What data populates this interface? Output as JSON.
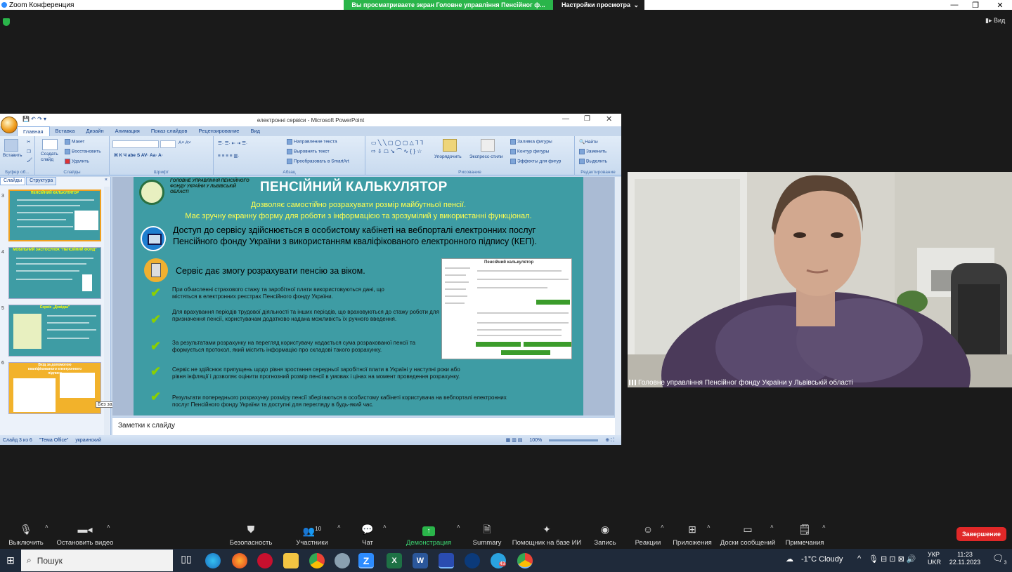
{
  "zoom": {
    "window_title": "Zoom Конференция",
    "share_banner": "Вы просматриваете экран Головне управління Пенсійног ф...",
    "view_settings": "Настройки просмотра",
    "view_label": "Вид"
  },
  "ppt": {
    "window_title": "електронні сервіси - Microsoft PowerPoint",
    "tabs": [
      "Главная",
      "Вставка",
      "Дизайн",
      "Анимация",
      "Показ слайдов",
      "Рецензирование",
      "Вид"
    ],
    "ribbon": {
      "paste": "Вставить",
      "clipboard_group": "Буфер об...",
      "layout": "Макет",
      "restore": "Восстановить",
      "delete": "Удалить",
      "new_slide": "Создать слайд",
      "slides_group": "Слайды",
      "font_group": "Шрифт",
      "text_direction": "Направление текста",
      "align_text": "Выровнять текст",
      "smartart": "Преобразовать в SmartArt",
      "paragraph_group": "Абзац",
      "arrange": "Упорядочить",
      "quick_styles": "Экспресс-стили",
      "shape_fill": "Заливка фигуры",
      "shape_outline": "Контур фигуры",
      "shape_effects": "Эффекты для фигур",
      "drawing_group": "Рисование",
      "find": "Найти",
      "replace": "Заменить",
      "select": "Выделить",
      "editing_group": "Редактирование"
    },
    "panel_tabs": [
      "Слайды",
      "Структура"
    ],
    "thumbnails": [
      {
        "num": "3",
        "title": "ПЕНСІЙНИЙ КАЛЬКУЛЯТОР"
      },
      {
        "num": "4",
        "title": "МОБІЛЬНИЙ ЗАСТОСУНОК \"ПЕНСІЙНИЙ ФОНД\""
      },
      {
        "num": "5",
        "title": "Сервіс „Довідка\""
      },
      {
        "num": "6",
        "title": "Вхід за допомогою кваліфікованого електронного підпису"
      }
    ],
    "tooltip": "Без заголовка",
    "notes_placeholder": "Заметки к слайду",
    "status": {
      "slide": "Слайд 3 из 6",
      "theme": "\"Тема Office\"",
      "language": "украинский",
      "zoom": "100%"
    },
    "slide": {
      "org": "ГОЛОВНЕ УПРАВЛІННЯ ПЕНСІЙНОГО ФОНДУ УКРАЇНИ У ЛЬВІВСЬКІЙ ОБЛАСТІ",
      "title": "ПЕНСІЙНИЙ КАЛЬКУЛЯТОР",
      "subtitle1": "Дозволяє самостійно розрахувати розмір майбутньої пенсії.",
      "subtitle2": "Має зручну екранну форму для роботи з інформацією  та зрозумілий у використанні функціонал.",
      "access": "Доступ до сервісу здійснюється в особистому кабінеті на вебпорталі електронних послуг Пенсійного фонду України з використанням кваліфікованого електронного підпису (КЕП).",
      "service": "Сервіс дає змогу розрахувати пенсію за віком.",
      "bullets": [
        "При обчисленні страхового стажу та заробітної плати використовуються дані, що містяться в електронних реєстрах Пенсійного фонду України.",
        "Для врахування періодів трудової діяльності та інших періодів, що враховуються до стажу роботи для призначення пенсії, користувачам додатково надана можливість їх ручного введення.",
        "За результатами розрахунку на перегляд користувачу надається сума розрахованої пенсії та формується протокол,  який містить інформацію про складові такого розрахунку.",
        "Сервіс не здійснює припущень щодо рівня зростання середньої заробітної плати в Україні у наступні роки або рівня інфляції і дозволяє оцінити прогнозний розмір пенсії в умовах і цінах на момент проведення розрахунку.",
        "Результати попереднього розрахунку розміру пенсії зберігаються в особистому кабінеті користувача на вебпорталі електронних послуг  Пенсійного фонду України та доступні для перегляду в будь-який час."
      ],
      "calc_title": "Пенсійний калькулятор"
    }
  },
  "camera": {
    "participant_name": "Головне управління Пенсійног фонду України у Львівській області"
  },
  "toolbar": {
    "mute": "Выключить звук",
    "stop_video": "Остановить видео",
    "security": "Безопасность",
    "participants": "Участники",
    "participants_count": "10",
    "chat": "Чат",
    "share_screen": "Демонстрация экрана",
    "summary": "Summary",
    "ai_companion": "Помощник на базе ИИ",
    "record": "Запись",
    "reactions": "Реакции",
    "apps": "Приложения",
    "whiteboards": "Доски сообщений",
    "notes": "Примечания",
    "end": "Завершение"
  },
  "taskbar": {
    "search": "Пошук",
    "weather": "-1°C  Cloudy",
    "lang": "УКР",
    "lang2": "UKR",
    "time": "11:23",
    "date": "22.11.2023",
    "notification_count": "3",
    "telegram_badge": "43"
  }
}
